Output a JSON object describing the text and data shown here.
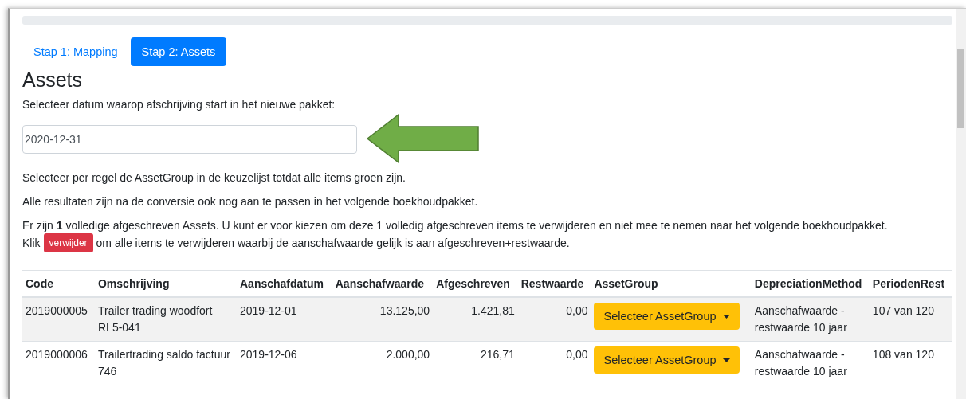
{
  "progress": {
    "level": 0
  },
  "tabs": [
    {
      "label": "Stap 1: Mapping",
      "selected": false
    },
    {
      "label": "Stap 2: Assets",
      "selected": true
    }
  ],
  "heading": "Assets",
  "date_label": "Selecteer datum waarop afschrijving start in het nieuwe pakket:",
  "date_field": {
    "value": "2020-12-31"
  },
  "instructions": [
    "Selecteer per regel de AssetGroup in de keuzelijst totdat alle items groen zijn.",
    "Alle resultaten zijn na de conversie ook nog aan te passen in het volgende boekhoudpakket."
  ],
  "notice": "Er zijn **1** volledige afgeschreven Assets. U kunt er voor kiezen om deze 1 volledig afgeschreven items te verwijderen en niet mee te nemen naar het volgende boekhoudpakket.",
  "click_prefix": "Klik",
  "delete_button": "verwijder",
  "click_suffix": "om alle items te verwijderen waarbij de aanschafwaarde gelijk is aan afgeschreven+restwaarde.",
  "table": {
    "columns": [
      "Code",
      "Omschrijving",
      "Aanschafdatum",
      "Aanschafwaarde",
      "Afgeschreven",
      "Restwaarde",
      "AssetGroup",
      "DepreciationMethod",
      "PeriodenRest"
    ],
    "rows": [
      {
        "code": "2019000005",
        "description": "Trailer trading woodfort RL5-041",
        "date": "2019-12-01",
        "purchase_value": "13.125,00",
        "depreciated": "1.421,81",
        "residual": "0,00",
        "asset_group": "Selecteer AssetGroup",
        "method": "Aanschafwaarde - restwaarde 10 jaar",
        "periods": "107 van 120"
      },
      {
        "code": "2019000006",
        "description": "Trailertrading saldo factuur 746",
        "date": "2019-12-06",
        "purchase_value": "2.000,00",
        "depreciated": "216,71",
        "residual": "0,00",
        "asset_group": "Selecteer AssetGroup",
        "method": "Aanschafwaarde - restwaarde 10 jaar",
        "periods": "108 van 120"
      }
    ]
  }
}
